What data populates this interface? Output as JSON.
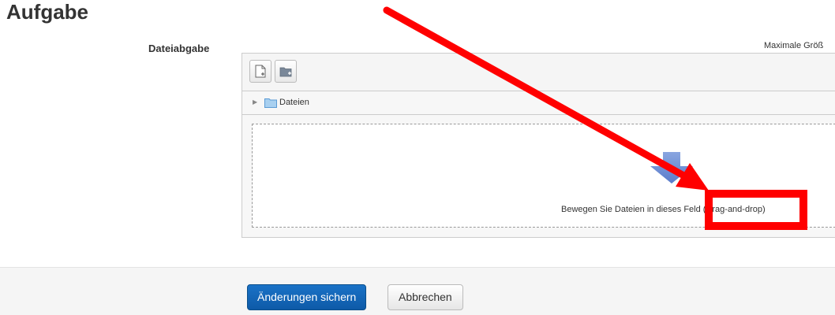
{
  "page": {
    "title": "Aufgabe"
  },
  "submission": {
    "field_label": "Dateiabgabe",
    "max_size_text": "Maximale Größ"
  },
  "filemanager": {
    "toolbar": {
      "add_file_icon": "add-file-icon",
      "create_folder_icon": "create-folder-icon"
    },
    "path": {
      "expand_icon": "triangle-right-icon",
      "folder_icon": "folder-icon",
      "label": "Dateien"
    },
    "dropzone": {
      "icon": "drop-arrow-icon",
      "text": "Bewegen Sie Dateien in dieses Feld (Drag-and-drop)"
    }
  },
  "footer": {
    "save_label": "Änderungen sichern",
    "cancel_label": "Abbrechen"
  },
  "colors": {
    "primary_button": "#0e5aa8",
    "annotation": "#ff0000",
    "folder": "#5b9bd5"
  }
}
